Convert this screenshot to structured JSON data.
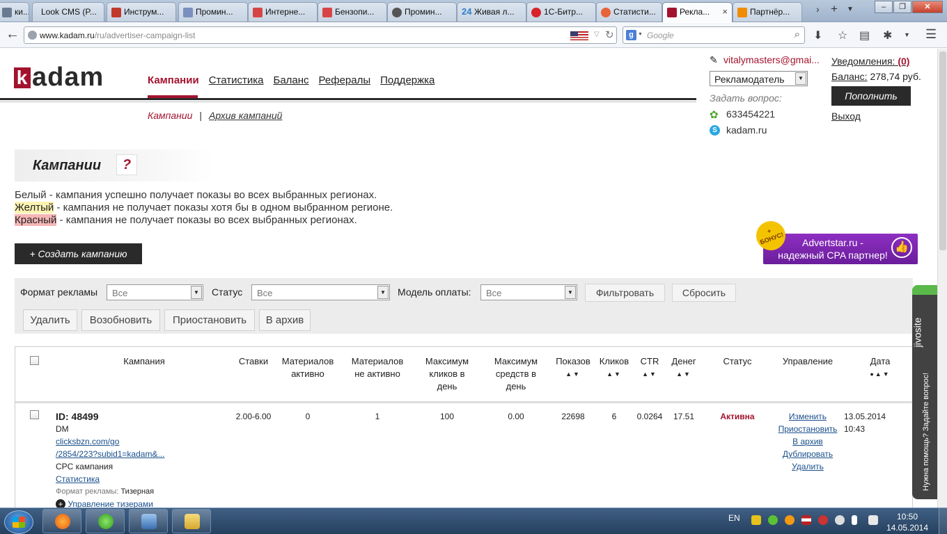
{
  "browser": {
    "tabs": [
      {
        "label": "ки...",
        "color": "#6a7b8f"
      },
      {
        "label": "Look CMS (P...",
        "color": "#e0e0e0"
      },
      {
        "label": "Инструм...",
        "color": "#c0392b"
      },
      {
        "label": "Промин...",
        "color": "#7a8fbf"
      },
      {
        "label": "Интерне...",
        "color": "#d64545"
      },
      {
        "label": "Бензопи...",
        "color": "#d64545"
      },
      {
        "label": "Промин...",
        "color": "#555555"
      },
      {
        "label": "Живая л...",
        "color": "#2d7ec9"
      },
      {
        "label": "1С-Битр...",
        "color": "#d8232a"
      },
      {
        "label": "Статисти...",
        "color": "#e8623a"
      },
      {
        "label": "Рекла...",
        "color": "#a3132e"
      },
      {
        "label": "Партнёр...",
        "color": "#f08c00"
      }
    ],
    "tab_icon_text": "24",
    "url_host": "www.kadam.ru",
    "url_path": "/ru/advertiser-campaign-list",
    "search_placeholder": "Google",
    "new_tab": "+",
    "close_tab": "×"
  },
  "site": {
    "logo_k": "k",
    "logo_rest": "adam",
    "nav": [
      "Кампании",
      "Статистика",
      "Баланс",
      "Рефералы",
      "Поддержка"
    ],
    "subnav_active": "Кампании",
    "subnav_sep": "|",
    "subnav_archive": "Архив кампаний"
  },
  "user": {
    "email": "vitalymasters@gmai...",
    "role": "Рекламодатель",
    "ask": "Задать вопрос:",
    "icq": "633454221",
    "skype": "kadam.ru",
    "notifications_label": "Уведомления:",
    "notifications_count": "(0)",
    "balance_label": "Баланс:",
    "balance_value": "278,74 руб.",
    "topup": "Пополнить",
    "logout": "Выход"
  },
  "page": {
    "title": "Кампании",
    "help": "?",
    "legend_white_word": "Белый",
    "legend_white_text": " - кампания успешно получает показы во всех выбранных регионах.",
    "legend_yellow_word": "Желтый",
    "legend_yellow_text": " - кампания не получает показы хотя бы в одном выбранном регионе.",
    "legend_red_word": "Красный",
    "legend_red_text": " - кампания не получает показы во всех выбранных регионах.",
    "create_button": "+ Создать кампанию",
    "banner_line1": "Advertstar.ru -",
    "banner_line2": "надежный CPA партнер!",
    "banner_badge_line1": "+",
    "banner_badge_line2": "БОНУС!"
  },
  "filters": {
    "format_label": "Формат рекламы",
    "format_value": "Все",
    "status_label": "Статус",
    "status_value": "Все",
    "payment_label": "Модель оплаты:",
    "payment_value": "Все",
    "filter_button": "Фильтровать",
    "reset_button": "Сбросить",
    "actions": [
      "Удалить",
      "Возобновить",
      "Приостановить",
      "В архив"
    ]
  },
  "table": {
    "headers": {
      "campaign": "Кампания",
      "bids": "Ставки",
      "mat_active_1": "Материалов",
      "mat_active_2": "активно",
      "mat_inactive_1": "Материалов",
      "mat_inactive_2": "не активно",
      "max_clicks_1": "Максимум",
      "max_clicks_2": "кликов в",
      "max_clicks_3": "день",
      "max_funds_1": "Максимум",
      "max_funds_2": "средств в",
      "max_funds_3": "день",
      "views": "Показов",
      "clicks": "Кликов",
      "ctr": "CTR",
      "money": "Денег",
      "status": "Статус",
      "control": "Управление",
      "date": "Дата",
      "sort": "▲▼",
      "sort_date": "●▲▼"
    },
    "row": {
      "id": "ID: 48499",
      "name": "DM",
      "link1": "clicksbzn.com/go",
      "link2": "/2854/223?subid1=kadam&...",
      "type": "CPC кампания",
      "stats_link": "Статистика",
      "format_label": "Формат рекламы:",
      "format_value": "Тизерная",
      "manage_teasers": "Управление тизерами",
      "bids": "2.00-6.00",
      "mat_active": "0",
      "mat_inactive": "1",
      "max_clicks": "100",
      "max_funds": "0.00",
      "views": "22698",
      "clicks": "6",
      "ctr": "0.0264",
      "money": "17.51",
      "status": "Активна",
      "actions": [
        "Изменить",
        "Приостановить",
        "В архив",
        "Дублировать",
        "Удалить"
      ],
      "date": "13.05.2014",
      "time": "10:43"
    }
  },
  "jivo": {
    "brand": "jivosite",
    "help": "Нужна помощь? Задайте вопрос!"
  },
  "taskbar": {
    "lang": "EN",
    "time": "10:50",
    "date": "14.05.2014"
  }
}
